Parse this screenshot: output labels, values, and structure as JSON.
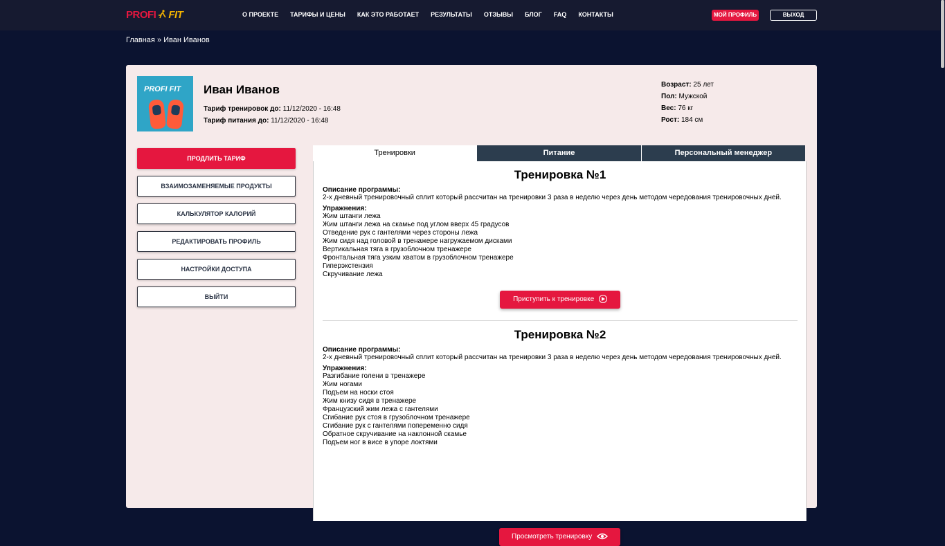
{
  "header": {
    "logo_part1": "PROFI",
    "logo_part2": "FIT",
    "nav": [
      "О ПРОЕКТЕ",
      "ТАРИФЫ И ЦЕНЫ",
      "КАК ЭТО РАБОТАЕТ",
      "РЕЗУЛЬТАТЫ",
      "ОТЗЫВЫ",
      "БЛОГ",
      "FAQ",
      "КОНТАКТЫ"
    ],
    "profile_button": "МОЙ ПРОФИЛЬ",
    "exit_button": "ВЫХОД"
  },
  "breadcrumb": {
    "home": "Главная",
    "sep": "»",
    "current": "Иван Иванов"
  },
  "profile": {
    "avatar_logo": "PROFI FIT",
    "name": "Иван Иванов",
    "training_label": "Тариф тренировок до:",
    "training_value": "11/12/2020 - 16:48",
    "nutrition_label": "Тариф питания до:",
    "nutrition_value": "11/12/2020 - 16:48",
    "age_label": "Возраст:",
    "age_value": "25 лет",
    "sex_label": "Пол:",
    "sex_value": "Мужской",
    "weight_label": "Вес:",
    "weight_value": "76 кг",
    "height_label": "Рост:",
    "height_value": "184 см"
  },
  "sidebar": [
    "ПРОДЛИТЬ ТАРИФ",
    "ВЗАИМОЗАМЕНЯЕМЫЕ ПРОДУКТЫ",
    "КАЛЬКУЛЯТОР КАЛОРИЙ",
    "РЕДАКТИРОВАТЬ ПРОФИЛЬ",
    "НАСТРОЙКИ ДОСТУПА",
    "ВЫЙТИ"
  ],
  "tabs": [
    "Тренировки",
    "Питание",
    "Персональный менеджер"
  ],
  "workouts": [
    {
      "title": "Тренировка №1",
      "desc_label": "Описание программы:",
      "desc": "2-х дневный тренировочный сплит который рассчитан на тренировки 3 раза в неделю через день методом чередования тренировочных дней.",
      "ex_label": "Упражнения:",
      "exercises": [
        "Жим штанги лежа",
        "Жим штанги лежа на скамье под углом вверх 45 градусов",
        "Отведение рук с гантелями через стороны лежа",
        "Жим сидя над головой в тренажере нагружаемом дисками",
        "Вертикальная тяга в грузоблочном тренажере",
        "Фронтальная тяга узким хватом в грузоблочном тренажере",
        "Гиперэкстензия",
        "Скручивание лежа"
      ],
      "button": "Приступить к тренировке",
      "button_icon": "play-circle-icon"
    },
    {
      "title": "Тренировка №2",
      "desc_label": "Описание программы:",
      "desc": "2-х дневный тренировочный сплит который рассчитан на тренировки 3 раза в неделю через день методом чередования тренировочных дней.",
      "ex_label": "Упражнения:",
      "exercises": [
        "Разгибание голени в тренажере",
        "Жим ногами",
        "Подъем на носки стоя",
        "Жим книзу сидя в тренажере",
        "Французский жим лежа с гантелями",
        "Сгибание рук стоя в грузоблочном тренажере",
        "Сгибание рук с гантелями попеременно сидя",
        "Обратное скручивание на наклонной скамье",
        "Подъем ног в висе в упоре локтями"
      ],
      "button": "Просмотреть тренировку",
      "button_icon": "eye-icon"
    }
  ],
  "colors": {
    "accent": "#e5173f",
    "dark_bg": "#0b1330",
    "topbar": "#161a30",
    "tab_dark": "#2c3d4e",
    "card_bg": "#f6eaea"
  }
}
